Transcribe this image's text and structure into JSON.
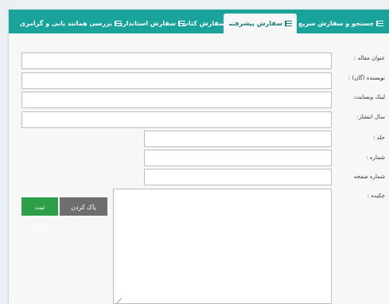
{
  "tabs": [
    {
      "label": "جستجو و سفارش سریع",
      "active": false
    },
    {
      "label": "سفارش پیشرفته",
      "active": true
    },
    {
      "label": "سفارش کتاب",
      "active": false
    },
    {
      "label": "سفارش استاندارد",
      "active": false
    },
    {
      "label": "بررسی همانند یابی و گرامری",
      "active": false
    }
  ],
  "icons": {
    "tab_icon": "list-icon"
  },
  "form": {
    "title_label": "عنوان مقاله :",
    "author_label": "نویسنده (گان) :",
    "website_label": "لینک وبسایت:",
    "year_label": "سال انتشار:",
    "volume_label": "جلد :",
    "issue_label": "شماره :",
    "page_label": "شماره صفحه",
    "abstract_label": "چکیده :",
    "title_value": "",
    "author_value": "",
    "website_value": "",
    "year_value": "",
    "volume_value": "",
    "issue_value": "",
    "page_value": "",
    "abstract_value": ""
  },
  "buttons": {
    "submit_label": "ثبت سفارش",
    "clear_label": "پاک کردن"
  },
  "colors": {
    "tab_bar": "#1aa39b",
    "submit_button": "#2f9e48",
    "clear_button": "#6e6e6e"
  }
}
